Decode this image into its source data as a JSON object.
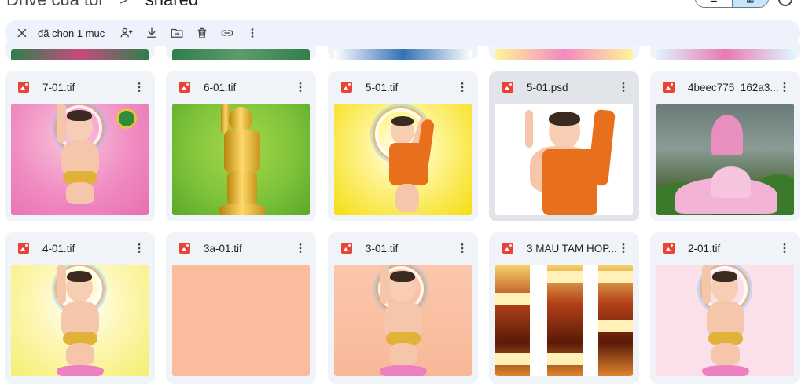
{
  "breadcrumb": {
    "root": "Drive của tôi",
    "separator": ">",
    "current": "shared"
  },
  "toolbar": {
    "selection_count": "đã chọn 1 mục"
  },
  "files": {
    "r1c1": {
      "name": "7-01.tif",
      "icon": "image-file-icon"
    },
    "r1c2": {
      "name": "6-01.tif",
      "icon": "image-file-icon"
    },
    "r1c3": {
      "name": "5-01.tif",
      "icon": "image-file-icon"
    },
    "r1c4": {
      "name": "5-01.psd",
      "icon": "image-file-icon",
      "selected": true
    },
    "r1c5": {
      "name": "4beec775_162a3...",
      "icon": "image-file-icon"
    },
    "r2c1": {
      "name": "4-01.tif",
      "icon": "image-file-icon"
    },
    "r2c2": {
      "name": "3a-01.tif",
      "icon": "image-file-icon"
    },
    "r2c3": {
      "name": "3-01.tif",
      "icon": "image-file-icon"
    },
    "r2c4": {
      "name": "3 MAU TAM HOP...",
      "icon": "image-file-icon"
    },
    "r2c5": {
      "name": "2-01.tif",
      "icon": "image-file-icon"
    }
  },
  "colors": {
    "accent": "#c2e7ff",
    "toolbar_bg": "#edf2fc",
    "card_bg": "#f0f4f9",
    "card_selected_bg": "#e1e5ea",
    "file_icon": "#ea4335"
  }
}
